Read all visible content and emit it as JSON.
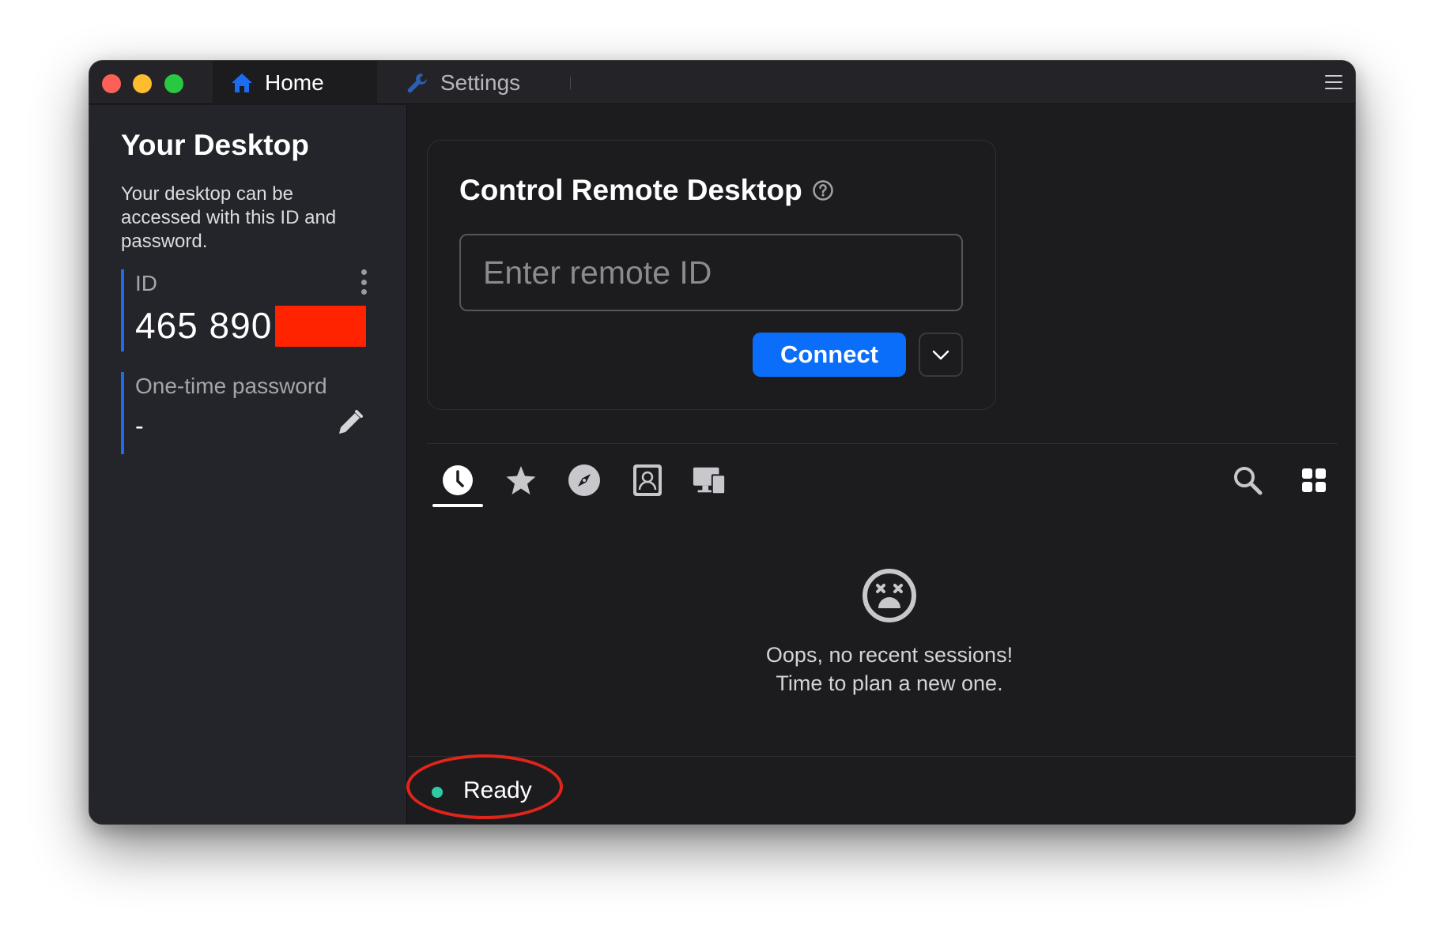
{
  "tabs": {
    "home_label": "Home",
    "settings_label": "Settings"
  },
  "sidebar": {
    "title": "Your Desktop",
    "description": "Your desktop can be accessed with this ID and password.",
    "id_label": "ID",
    "id_value": "465 890",
    "password_label": "One-time password",
    "password_value": "-"
  },
  "connect": {
    "title": "Control Remote Desktop",
    "input_placeholder": "Enter remote ID",
    "input_value": "",
    "button_label": "Connect"
  },
  "sessions": {
    "tabs": [
      "recent-sessions",
      "favorites",
      "discovered",
      "address-book",
      "group"
    ],
    "active_tab": "recent-sessions",
    "empty_line1": "Oops, no recent sessions!",
    "empty_line2": "Time to plan a new one."
  },
  "status": {
    "label": "Ready",
    "color": "#2fc9a2"
  },
  "colors": {
    "accent": "#0a6efb",
    "highlight": "#e1251b",
    "redaction": "#ff2300"
  }
}
